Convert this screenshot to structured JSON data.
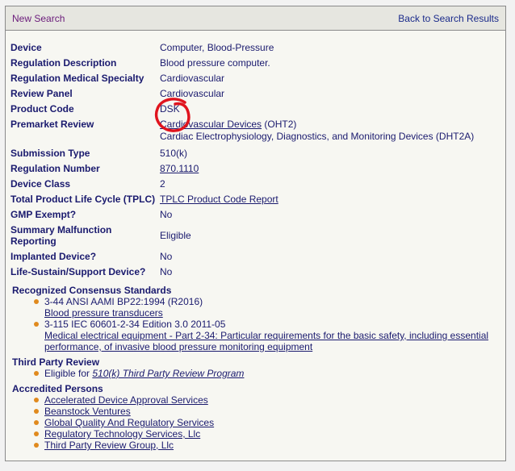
{
  "header": {
    "new_search": "New Search",
    "back_to_results": "Back to Search Results"
  },
  "details": {
    "device": {
      "label": "Device",
      "value": "Computer, Blood-Pressure"
    },
    "regulation_description": {
      "label": "Regulation Description",
      "value": "Blood pressure computer."
    },
    "regulation_medical_specialty": {
      "label": "Regulation Medical Specialty",
      "value": "Cardiovascular"
    },
    "review_panel": {
      "label": "Review Panel",
      "value": "Cardiovascular"
    },
    "product_code": {
      "label": "Product Code",
      "value": "DSK"
    },
    "premarket_review": {
      "label": "Premarket Review",
      "office_link": "Cardiovascular Devices",
      "office_code": " (OHT2)",
      "division": "Cardiac Electrophysiology, Diagnostics, and Monitoring Devices (DHT2A)"
    },
    "submission_type": {
      "label": "Submission Type",
      "value": "510(k)"
    },
    "regulation_number": {
      "label": "Regulation Number",
      "value": "870.1110"
    },
    "device_class": {
      "label": "Device Class",
      "value": "2"
    },
    "tplc": {
      "label": "Total Product Life Cycle (TPLC)",
      "value": "TPLC Product Code Report"
    },
    "gmp_exempt": {
      "label": "GMP Exempt?",
      "value": "No"
    },
    "summary_malfunction": {
      "label_line1": "Summary Malfunction",
      "label_line2": "Reporting",
      "value": "Eligible"
    },
    "implanted_device": {
      "label": "Implanted Device?",
      "value": "No"
    },
    "life_sustain": {
      "label": "Life-Sustain/Support Device?",
      "value": "No"
    }
  },
  "standards": {
    "title": "Recognized Consensus Standards",
    "items": [
      {
        "id": "3-44 ANSI AAMI BP22:1994 (R2016)",
        "link": "Blood pressure transducers"
      },
      {
        "id": "3-115 IEC 60601-2-34 Edition 3.0 2011-05",
        "link_line1": "Medical electrical equipment - Part 2-34: Particular requirements for the basic safety, including essential",
        "link_line2": "performance, of invasive blood pressure monitoring equipment"
      }
    ]
  },
  "third_party": {
    "title": "Third Party Review",
    "prefix": "Eligible for ",
    "link": "510(k) Third Party Review Program"
  },
  "accredited": {
    "title": "Accredited Persons",
    "items": [
      "Accelerated Device Approval Services",
      "Beanstock Ventures",
      "Global Quality And Regulatory Services",
      "Regulatory Technology Services, Llc",
      "Third Party Review Group, Llc"
    ]
  },
  "annotation": {
    "color": "#e0141e"
  }
}
